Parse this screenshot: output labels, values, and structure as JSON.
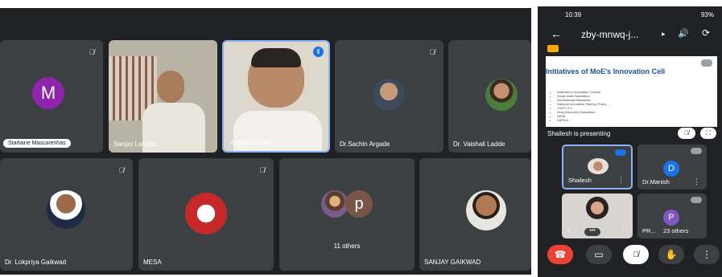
{
  "desktop": {
    "tiles": [
      {
        "name": "Starlaine Mascarenhas",
        "initial": "M",
        "avatar_color": "#8e24aa"
      },
      {
        "name": "Sanjay Lakade"
      },
      {
        "name": "Abhinav Dube"
      },
      {
        "name": "Dr.Sachin Argade"
      },
      {
        "name": "Dr. Vaishali Ladde"
      },
      {
        "name": "Dr. Lokpriya Gaikwad"
      },
      {
        "name": "MESA"
      },
      {
        "name": "11 others",
        "initial": "p"
      },
      {
        "name": "SANJAY GAIKWAD"
      }
    ]
  },
  "phone": {
    "status": {
      "time": "10:39",
      "right": "93%"
    },
    "meeting_code": "zby-mnwq-j...",
    "slide": {
      "title": "Initiatives of MoE's Innovation Cell",
      "bullets": [
        "Institution's Innovation Council",
        "Smart India Hackathon",
        "International Hackathon",
        "National Innovation Start-up Policy",
        "YUKTI 2.0",
        "Drug Discovery Hackathon",
        "ARIIA",
        "KAPILA"
      ]
    },
    "presenting_label": "Shailesh is presenting",
    "tiles": [
      {
        "name": "Shailesh"
      },
      {
        "name": "Dr.Manish",
        "initial": "D",
        "avatar_color": "#1a73e8"
      },
      {
        "name": "Y..."
      },
      {
        "name": "PR...",
        "initial": "P",
        "avatar_color": "#7e57c2",
        "others": "23 others"
      }
    ]
  },
  "colors": {
    "end_call": "#ea4335",
    "tile_bg": "#3c4043",
    "bg": "#202124"
  }
}
